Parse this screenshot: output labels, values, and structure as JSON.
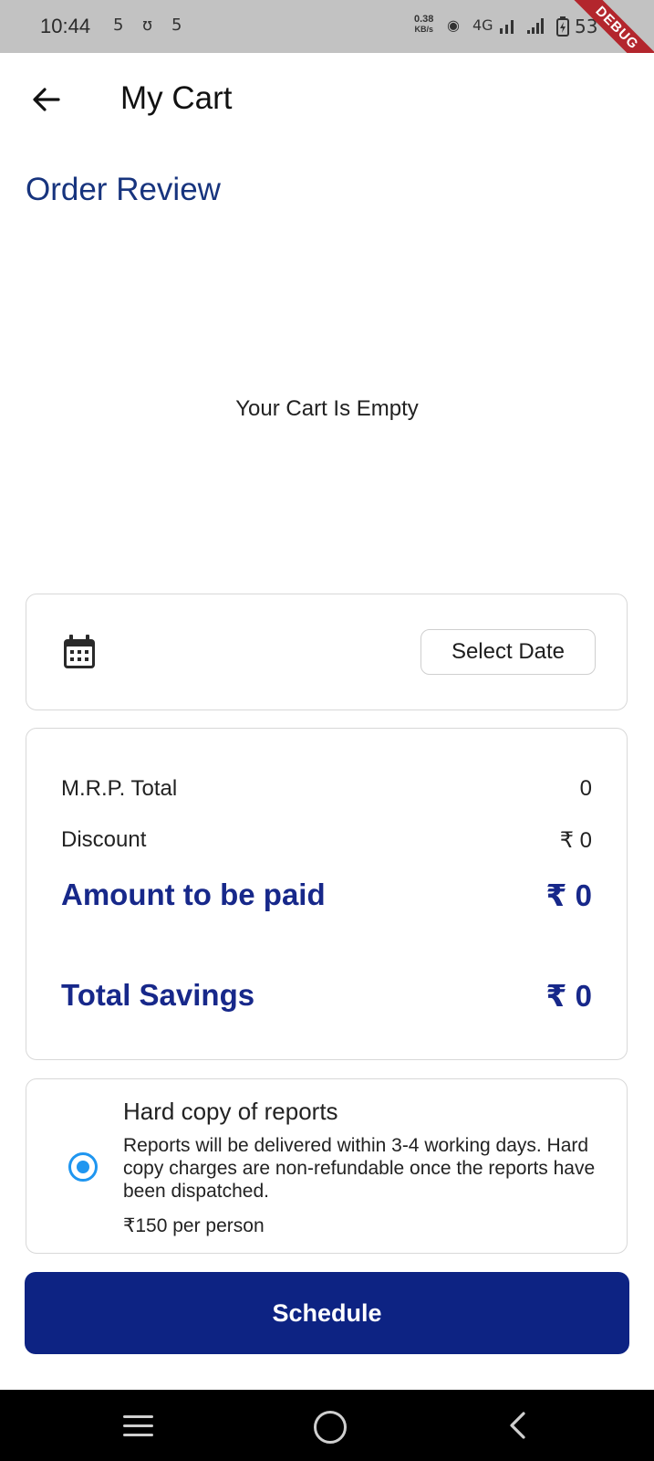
{
  "status_bar": {
    "time": "10:44",
    "notif_icons": [
      "5",
      "ʊ",
      "5"
    ],
    "net_speed_value": "0.38",
    "net_speed_unit": "KB/s",
    "network": "4G",
    "battery": "53",
    "debug_label": "DEBUG"
  },
  "app_bar": {
    "title": "My Cart"
  },
  "section_title": "Order Review",
  "cart": {
    "empty_message": "Your Cart Is Empty"
  },
  "date_card": {
    "select_label": "Select Date"
  },
  "summary": {
    "mrp_label": "M.R.P. Total",
    "mrp_value": "0",
    "discount_label": "Discount",
    "discount_value": "₹ 0",
    "amount_label": "Amount to be paid",
    "amount_value": "₹ 0",
    "savings_label": "Total Savings",
    "savings_value": "₹ 0"
  },
  "hard_copy": {
    "title": "Hard copy of reports",
    "description": "Reports will be delivered within 3-4 working days. Hard copy charges are non-refundable once the reports have been dispatched.",
    "price": "₹150 per person",
    "selected": true
  },
  "schedule_label": "Schedule",
  "colors": {
    "primary": "#0d2383",
    "accent_text": "#17288a",
    "radio": "#1f96f0"
  }
}
